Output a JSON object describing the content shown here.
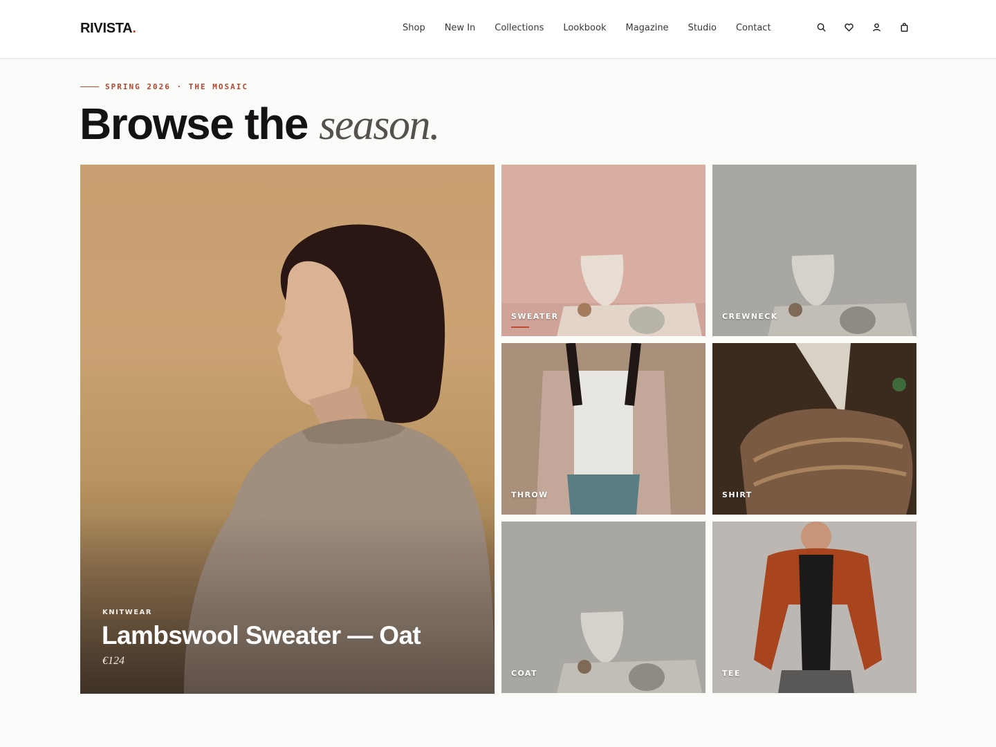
{
  "brand": {
    "name": "RIVISTA",
    "dot": ".",
    "accent": "#c0492f"
  },
  "nav": {
    "items": [
      "Shop",
      "New In",
      "Collections",
      "Lookbook",
      "Magazine",
      "Studio",
      "Contact"
    ]
  },
  "header_icons": [
    "search-icon",
    "heart-icon",
    "user-icon",
    "bag-icon"
  ],
  "hero": {
    "eyebrow": "SPRING 2026 · THE MOSAIC",
    "title_main": "Browse the",
    "title_italic": "season."
  },
  "feature": {
    "category": "KNITWEAR",
    "title": "Lambswool Sweater — Oat",
    "price": "€124"
  },
  "tiles": [
    {
      "label": "SWEATER",
      "active": true
    },
    {
      "label": "CREWNECK",
      "active": false
    },
    {
      "label": "THROW",
      "active": false
    },
    {
      "label": "SHIRT",
      "active": false
    },
    {
      "label": "COAT",
      "active": false
    },
    {
      "label": "TEE",
      "active": false
    }
  ]
}
